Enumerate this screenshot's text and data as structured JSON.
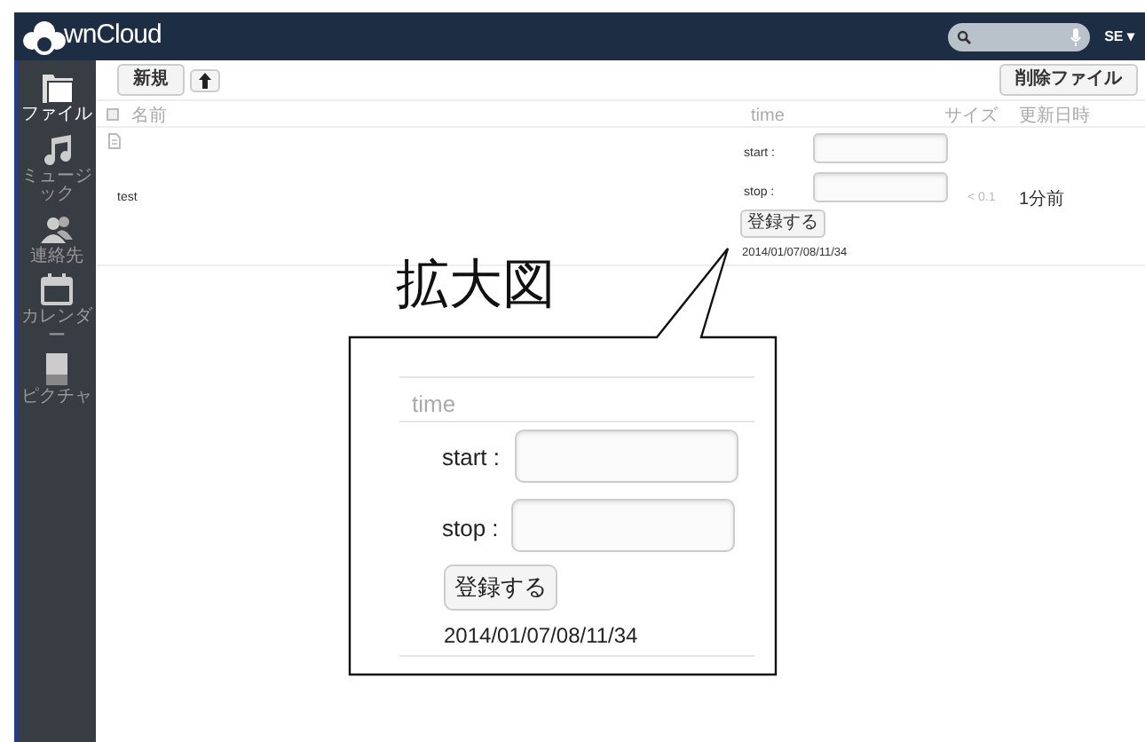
{
  "header": {
    "logo_text": "wnCloud",
    "user": "SE ▾"
  },
  "sidebar": {
    "items": [
      {
        "label": "ファイル",
        "kind": "folder",
        "selected": true
      },
      {
        "label": "ミュージック",
        "kind": "music",
        "selected": false
      },
      {
        "label": "連絡先",
        "kind": "contacts",
        "selected": false
      },
      {
        "label": "カレンダー",
        "kind": "calendar",
        "selected": false
      },
      {
        "label": "ピクチャ",
        "kind": "picture",
        "selected": false
      }
    ]
  },
  "toolbar": {
    "new_button": "新規",
    "delete_button": "削除ファイル"
  },
  "table": {
    "select_all_checked": false,
    "columns": [
      "名前",
      "time",
      "サイズ",
      "更新日時"
    ],
    "rows": [
      {
        "name": "test",
        "start_label": "start :",
        "stop_label": "stop :",
        "register_button": "登録する",
        "timestamp": "2014/01/07/08/11/34",
        "size": "< 0.1",
        "modified": "1分前"
      }
    ]
  },
  "callout": {
    "title": "拡大図",
    "column": "time",
    "start_label": "start :",
    "stop_label": "stop :",
    "register_button": "登録する",
    "timestamp": "2014/01/07/08/11/34"
  }
}
